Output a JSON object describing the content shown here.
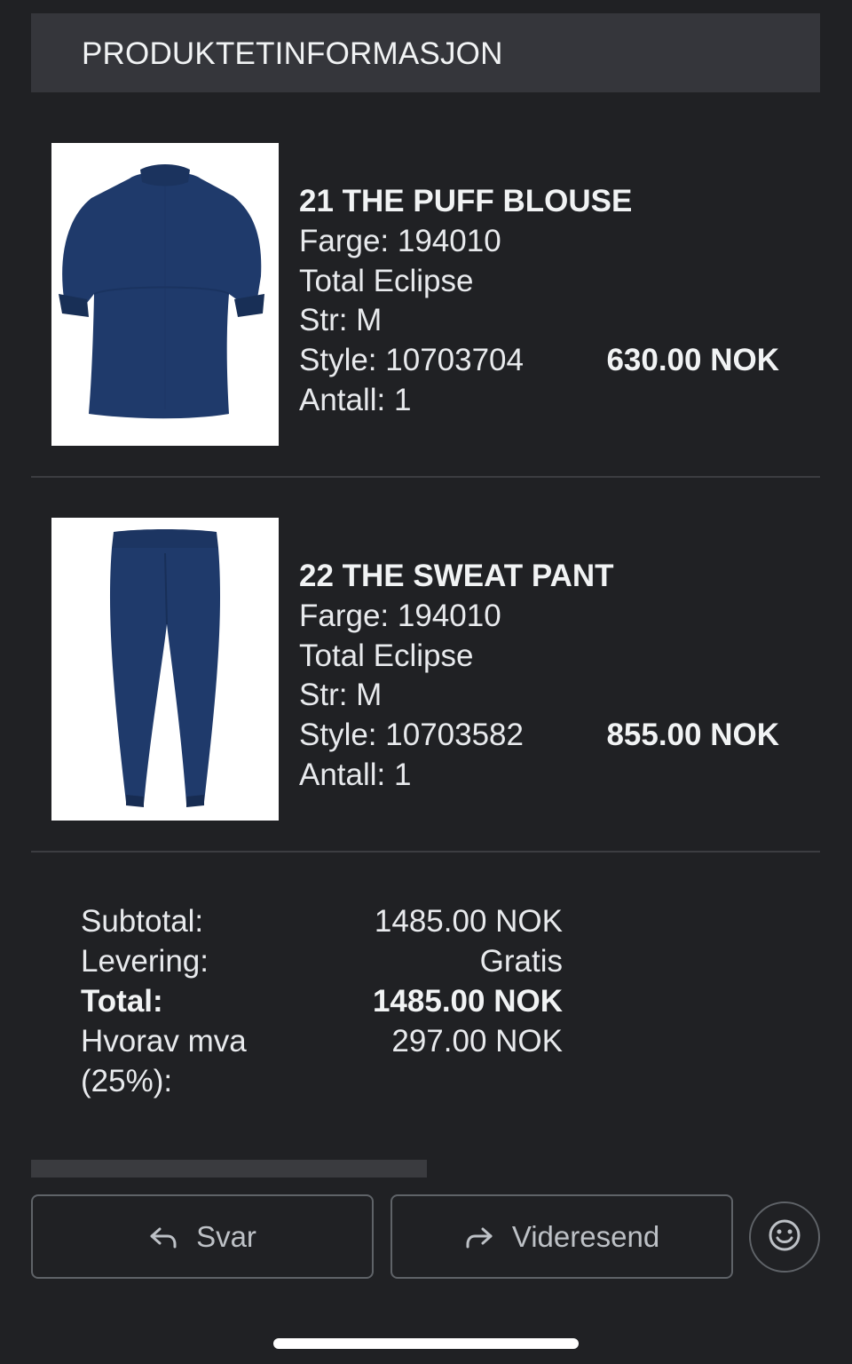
{
  "header": {
    "title": "PRODUKTETINFORMASJON"
  },
  "products": [
    {
      "name": "21 THE PUFF BLOUSE",
      "color": "Farge: 194010",
      "color_name": "Total Eclipse",
      "size": "Str: M",
      "style": "Style: 10703704",
      "quantity": "Antall: 1",
      "price": "630.00 NOK",
      "image_icon": "blouse-image"
    },
    {
      "name": "22 THE SWEAT PANT",
      "color": "Farge: 194010",
      "color_name": "Total Eclipse",
      "size": "Str: M",
      "style": "Style: 10703582",
      "quantity": "Antall: 1",
      "price": "855.00 NOK",
      "image_icon": "pant-image"
    }
  ],
  "summary": {
    "subtotal_label": "Subtotal:",
    "subtotal_value": "1485.00 NOK",
    "delivery_label": "Levering:",
    "delivery_value": "Gratis",
    "total_label": "Total:",
    "total_value": "1485.00 NOK",
    "vat_label_line1": "Hvorav mva",
    "vat_label_line2": "(25%):",
    "vat_value": "297.00 NOK"
  },
  "actions": {
    "reply_label": "Svar",
    "reply_icon": "reply-arrow-icon",
    "forward_label": "Videresend",
    "forward_icon": "forward-arrow-icon",
    "emoji_icon": "smiley-icon"
  },
  "colors": {
    "background": "#202124",
    "header_bar": "#35363b",
    "product_navy": "#1f3a6b"
  }
}
